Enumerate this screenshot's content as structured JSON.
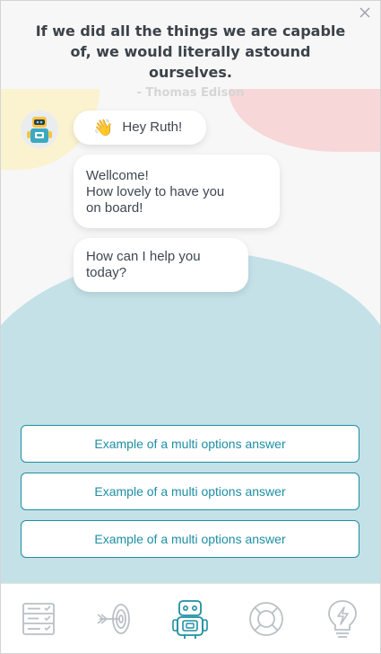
{
  "quote": {
    "text": "If we did all the things we are capable of, we would literally astound ourselves.",
    "author": "- Thomas Edison"
  },
  "chat": {
    "greeting_emoji": "👋",
    "greeting": "Hey Ruth!",
    "welcome": "Wellcome!\nHow lovely to have you\non board!",
    "question": "How can I help you\ntoday?"
  },
  "options": [
    "Example of a multi options answer",
    "Example of a multi options answer",
    "Example of a multi options answer"
  ],
  "nav": {
    "items": [
      "checklist-icon",
      "target-icon",
      "robot-icon",
      "lifebuoy-icon",
      "lightbulb-icon"
    ],
    "active": "robot-icon"
  },
  "colors": {
    "accent": "#1e8fa3",
    "blob_blue": "#c4e1e8",
    "blob_pink": "#f7d7d7",
    "blob_yellow": "#fbf2cf",
    "icon_gray": "#b9c0c6"
  }
}
